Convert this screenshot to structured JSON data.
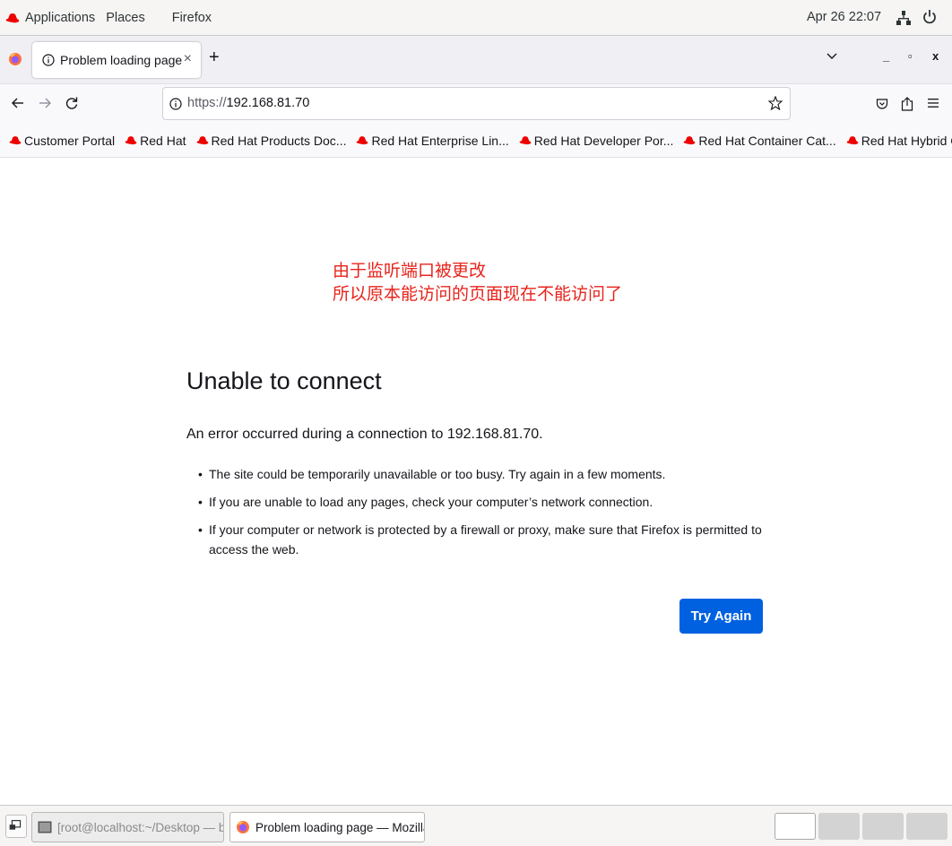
{
  "topbar": {
    "applications": "Applications",
    "places": "Places",
    "app_name": "Firefox",
    "clock": "Apr 26  22:07"
  },
  "tabs": {
    "active_title": "Problem loading page",
    "close_glyph": "×",
    "new_tab_glyph": "+"
  },
  "window_controls": {
    "minimize": "_",
    "maximize": "▫",
    "close": "x"
  },
  "navbar": {
    "url_scheme": "https://",
    "url_host": "192.168.81.70"
  },
  "bookmarks": [
    "Customer Portal",
    "Red Hat",
    "Red Hat Products Doc...",
    "Red Hat Enterprise Lin...",
    "Red Hat Developer Por...",
    "Red Hat Container Cat...",
    "Red Hat Hybrid Cloud ..."
  ],
  "annotation": {
    "line1": "由于监听端口被更改",
    "line2": "所以原本能访问的页面现在不能访问了",
    "color": "#e8231c"
  },
  "error_page": {
    "title": "Unable to connect",
    "description": "An error occurred during a connection to 192.168.81.70.",
    "bullets": [
      "The site could be temporarily unavailable or too busy. Try again in a few moments.",
      "If you are unable to load any pages, check your computer’s network connection.",
      "If your computer or network is protected by a firewall or proxy, make sure that Firefox is permitted to access the web."
    ],
    "try_again_label": "Try Again",
    "button_color": "#0061e0"
  },
  "taskbar": {
    "terminal_task": "[root@localhost:~/Desktop — bash]",
    "firefox_task": "Problem loading page — Mozilla F..."
  },
  "icons": [
    "redhat-logo-icon",
    "network-icon",
    "power-icon",
    "firefox-icon",
    "info-icon",
    "back-arrow-icon",
    "forward-arrow-icon",
    "reload-icon",
    "bookmark-star-icon",
    "pocket-icon",
    "share-icon",
    "menu-icon",
    "terminal-icon",
    "show-desktop-icon"
  ]
}
